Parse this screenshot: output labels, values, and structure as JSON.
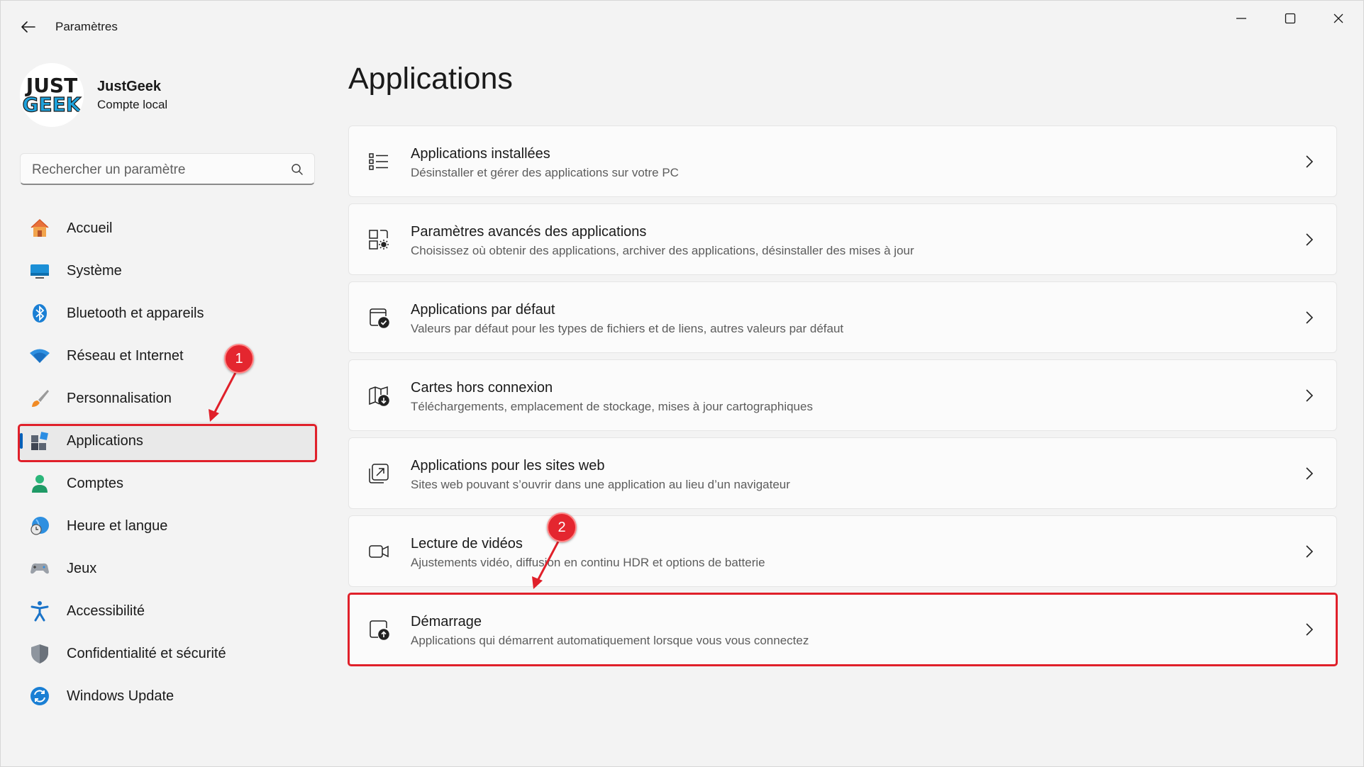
{
  "titlebar": {
    "title": "Paramètres",
    "controls": [
      "minimize",
      "maximize",
      "close"
    ]
  },
  "profile": {
    "logo_line1": "JUST",
    "logo_line2": "GEEK",
    "name": "JustGeek",
    "account_type": "Compte local"
  },
  "search": {
    "placeholder": "Rechercher un paramètre",
    "value": ""
  },
  "sidebar": {
    "items": [
      {
        "label": "Accueil",
        "icon": "home-icon"
      },
      {
        "label": "Système",
        "icon": "system-icon"
      },
      {
        "label": "Bluetooth et appareils",
        "icon": "bluetooth-icon"
      },
      {
        "label": "Réseau et Internet",
        "icon": "wifi-icon"
      },
      {
        "label": "Personnalisation",
        "icon": "brush-icon"
      },
      {
        "label": "Applications",
        "icon": "apps-icon",
        "selected": true
      },
      {
        "label": "Comptes",
        "icon": "user-icon"
      },
      {
        "label": "Heure et langue",
        "icon": "clock-globe-icon"
      },
      {
        "label": "Jeux",
        "icon": "gamepad-icon"
      },
      {
        "label": "Accessibilité",
        "icon": "accessibility-icon"
      },
      {
        "label": "Confidentialité et sécurité",
        "icon": "shield-icon"
      },
      {
        "label": "Windows Update",
        "icon": "update-icon"
      }
    ]
  },
  "main": {
    "title": "Applications",
    "cards": [
      {
        "title": "Applications installées",
        "description": "Désinstaller et gérer des applications sur votre PC",
        "icon": "list-icon"
      },
      {
        "title": "Paramètres avancés des applications",
        "description": "Choisissez où obtenir des applications, archiver des applications, désinstaller des mises à jour",
        "icon": "advanced-apps-icon"
      },
      {
        "title": "Applications par défaut",
        "description": "Valeurs par défaut pour les types de fichiers et de liens, autres valeurs par défaut",
        "icon": "default-apps-icon"
      },
      {
        "title": "Cartes hors connexion",
        "description": "Téléchargements, emplacement de stockage, mises à jour cartographiques",
        "icon": "offline-maps-icon"
      },
      {
        "title": "Applications pour les sites web",
        "description": "Sites web pouvant s’ouvrir dans une application au lieu d’un navigateur",
        "icon": "open-external-icon"
      },
      {
        "title": "Lecture de vidéos",
        "description": "Ajustements vidéo, diffusion en continu HDR et options de batterie",
        "icon": "video-icon"
      },
      {
        "title": "Démarrage",
        "description": "Applications qui démarrent automatiquement lorsque vous vous connectez",
        "icon": "startup-icon"
      }
    ]
  },
  "annotations": {
    "badge_1": "1",
    "badge_2": "2",
    "color": "#e0202a"
  },
  "colors": {
    "accent": "#005fb8",
    "background": "#f3f3f3",
    "card": "#fbfbfb"
  }
}
